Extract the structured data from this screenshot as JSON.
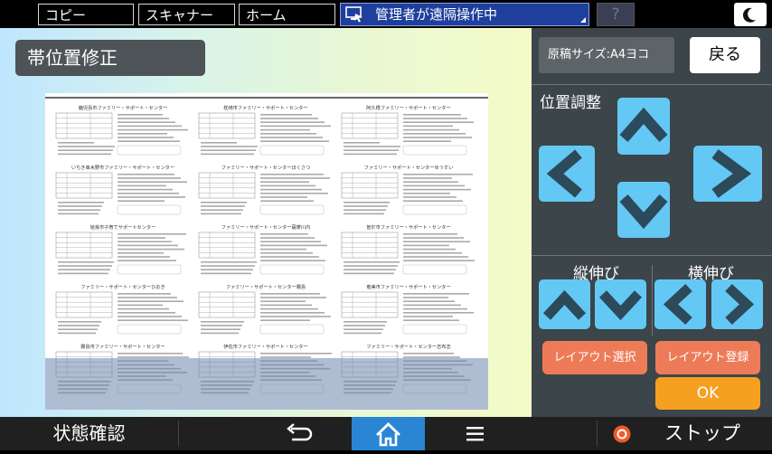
{
  "topbar": {
    "tabs": [
      {
        "label": "コピー"
      },
      {
        "label": "スキャナー"
      },
      {
        "label": "ホーム"
      }
    ],
    "remote_status": "管理者が遠隔操作中",
    "help_label": "?"
  },
  "screen": {
    "title": "帯位置修正"
  },
  "preview": {
    "column_titles": [
      [
        "鹿児島市ファミリー・サポート・センター",
        "いちき串木野市ファミリー・サポート・センター",
        "姶良市子育てサポートセンター",
        "ファミリー・サポート・センターひおき",
        "霧島市ファミリー・サポート・センター"
      ],
      [
        "枕崎市ファミリー・サポート・センター",
        "ファミリー・サポート・センターほくさつ",
        "ファミリー・サポート・センター薩摩川内",
        "ファミリー・サポート・センター霧島",
        "伊佐市ファミリー・サポート・センター"
      ],
      [
        "阿久根ファミリー・サポート・センター",
        "ファミリー・サポート・センターゆうすい",
        "曽於市ファミリー・サポート・センター",
        "奄美市ファミリー・サポート・センター",
        "ファミリー・サポート・センター志布志"
      ]
    ]
  },
  "panel": {
    "doc_size": "原稿サイズ:A4ヨコ",
    "back_label": "戻る",
    "position_label": "位置調整",
    "vertical_stretch_label": "縦伸び",
    "horizontal_stretch_label": "横伸び",
    "layout_select_label": "レイアウト選択",
    "layout_register_label": "レイアウト登録",
    "ok_label": "OK"
  },
  "bottombar": {
    "status_label": "状態確認",
    "stop_label": "ストップ"
  },
  "colors": {
    "accent_blue": "#64c8f5",
    "layout_button": "#ee7b57",
    "ok_button": "#f5a020",
    "home_active": "#2a86d4"
  }
}
